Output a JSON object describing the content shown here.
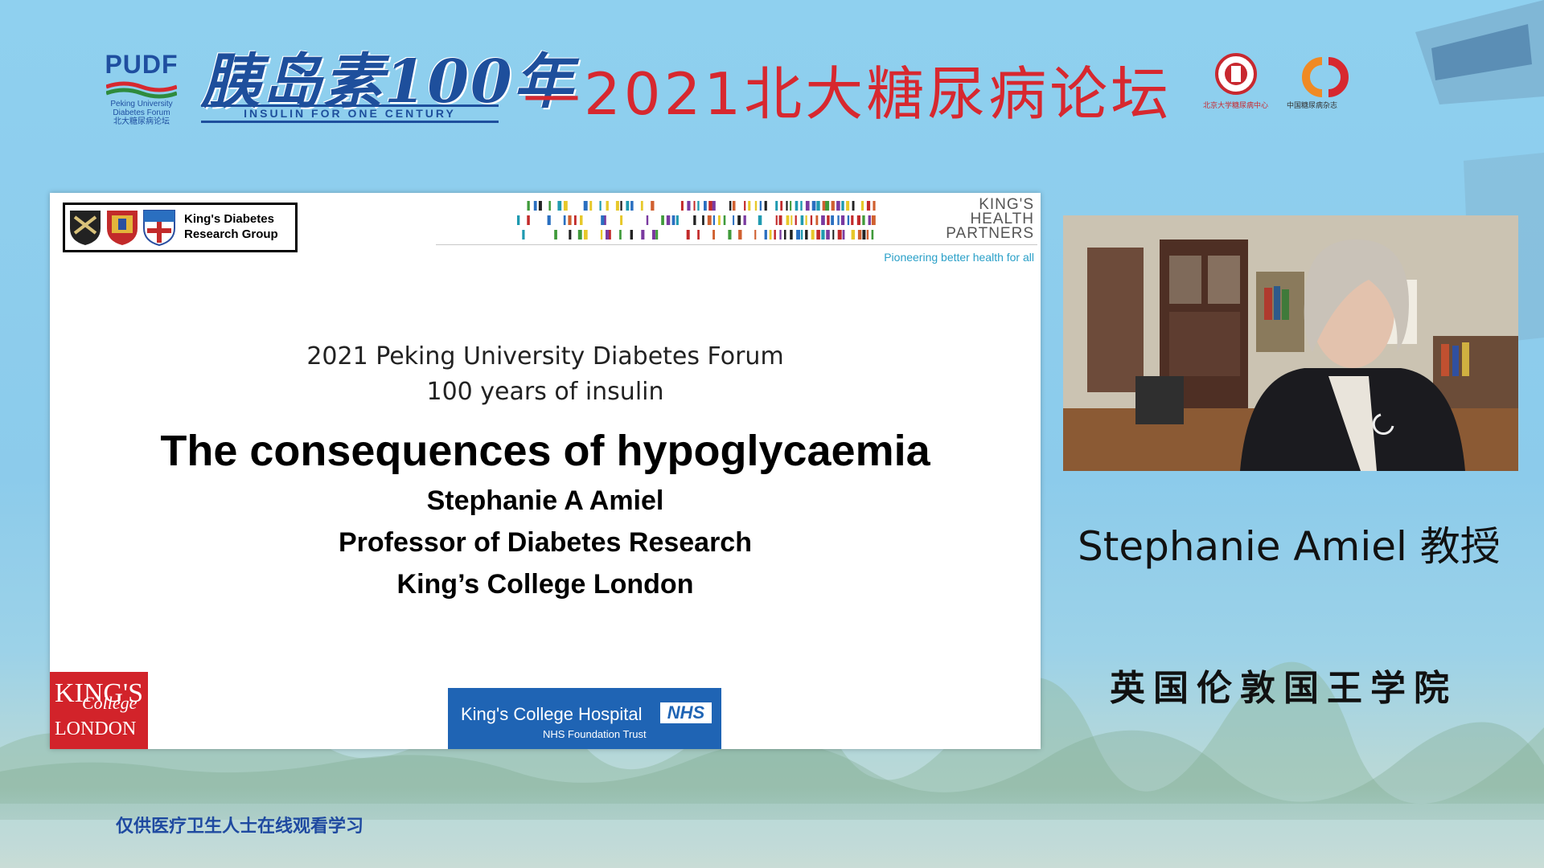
{
  "header": {
    "pudf": {
      "acronym": "PUDF",
      "english": "Peking University Diabetes Forum",
      "chinese": "北大糖尿病论坛"
    },
    "insulin_title": "胰岛素100年",
    "insulin_subtitle": "INSULIN FOR ONE CENTURY",
    "forum_title": "—2021北大糖尿病论坛",
    "partner_logo_1_caption": "北京大学糖尿病中心",
    "partner_logo_2_caption": "中国糖尿病杂志"
  },
  "slide": {
    "kdrg_label": "King's Diabetes Research Group",
    "kdrg_line1": "King's Diabetes",
    "kdrg_line2": "Research Group",
    "khp_line1": "KING'S",
    "khp_line2": "HEALTH",
    "khp_line3": "PARTNERS",
    "khp_tagline": "Pioneering better health for all",
    "line1": "2021 Peking University Diabetes Forum",
    "line2": "100 years of insulin",
    "title": "The consequences of hypoglycaemia",
    "author": "Stephanie A Amiel",
    "role": "Professor of Diabetes Research",
    "institution": "King’s College London",
    "kcl_logo": {
      "k": "KING'S",
      "college": "College",
      "london": "LONDON"
    },
    "kch_logo": {
      "name": "King's College Hospital",
      "nhs": "NHS",
      "trust": "NHS Foundation Trust"
    }
  },
  "speaker": {
    "name": "Stephanie Amiel  教授",
    "affiliation": "英国伦敦国王学院"
  },
  "footer": {
    "disclaimer": "仅供医疗卫生人士在线观看学习"
  },
  "colors": {
    "forum_red": "#d7282f",
    "insulin_blue": "#1e4f9c",
    "kcl_red": "#d2232a",
    "nhs_blue": "#1f64b4",
    "tagline_cyan": "#2aa0c8"
  }
}
